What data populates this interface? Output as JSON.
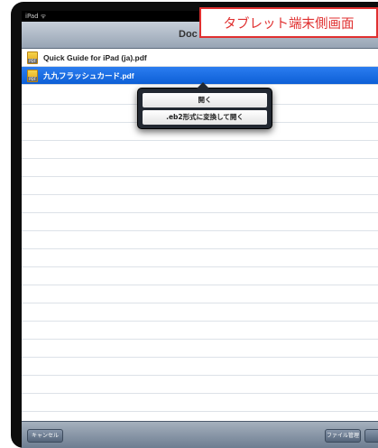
{
  "status_bar": {
    "carrier": "iPad ᯤ"
  },
  "nav_bar": {
    "title": "Doc"
  },
  "files": [
    {
      "name": "Quick Guide for iPad (ja).pdf",
      "icon": "pdf-file-icon",
      "selected": false
    },
    {
      "name": "九九フラッシュカード.pdf",
      "icon": "pdf-file-icon",
      "selected": true
    }
  ],
  "popover": {
    "open_label": "開く",
    "convert_label": ".eb2形式に変換して開く"
  },
  "toolbar": {
    "cancel_label": "キャンセル",
    "file_manage_label": "ファイル管理"
  },
  "caption": {
    "text": "タブレット端末側画面",
    "color": "#e03030"
  },
  "colors": {
    "selection": "#1a6ee6",
    "caption_border": "#e03030"
  }
}
